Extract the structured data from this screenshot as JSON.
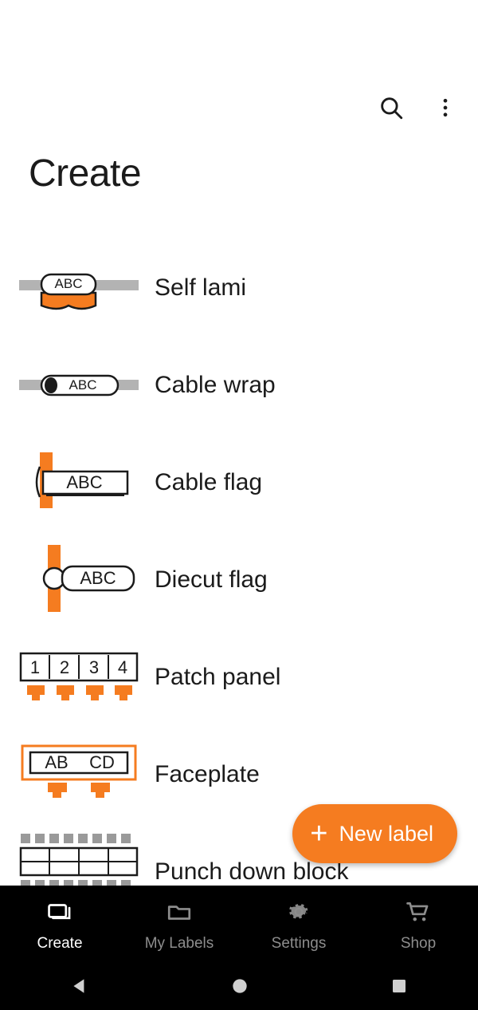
{
  "app": {
    "header": {
      "title": "Create",
      "search_icon": "search-icon",
      "overflow_icon": "more-vertical-icon"
    },
    "list_items": [
      {
        "label": "Self lami",
        "icon": "self-laminating-label-icon"
      },
      {
        "label": "Cable wrap",
        "icon": "cable-wrap-label-icon"
      },
      {
        "label": "Cable flag",
        "icon": "cable-flag-label-icon"
      },
      {
        "label": "Diecut flag",
        "icon": "diecut-flag-label-icon"
      },
      {
        "label": "Patch panel",
        "icon": "patch-panel-label-icon"
      },
      {
        "label": "Faceplate",
        "icon": "faceplate-label-icon"
      },
      {
        "label": "Punch down block",
        "icon": "punch-down-block-label-icon"
      }
    ],
    "icon_sample_text": {
      "abc": "ABC",
      "patch_panel": [
        "1",
        "2",
        "3",
        "4"
      ],
      "faceplate_left": "AB",
      "faceplate_right": "CD"
    },
    "fab": {
      "label": "New label",
      "plus_icon": "plus-icon"
    },
    "bottom_nav": [
      {
        "label": "Create",
        "icon": "create-label-icon",
        "active": true
      },
      {
        "label": "My Labels",
        "icon": "folder-icon",
        "active": false
      },
      {
        "label": "Settings",
        "icon": "gear-icon",
        "active": false
      },
      {
        "label": "Shop",
        "icon": "shopping-cart-icon",
        "active": false
      }
    ],
    "system_nav": [
      {
        "icon": "back-triangle-icon"
      },
      {
        "icon": "home-circle-icon"
      },
      {
        "icon": "recents-square-icon"
      }
    ],
    "colors": {
      "accent": "#f57c20",
      "text": "#1b1b1b",
      "nav_bar": "#000000",
      "nav_inactive": "#8d8d8d",
      "gray_cable": "#b3b3b3"
    }
  }
}
